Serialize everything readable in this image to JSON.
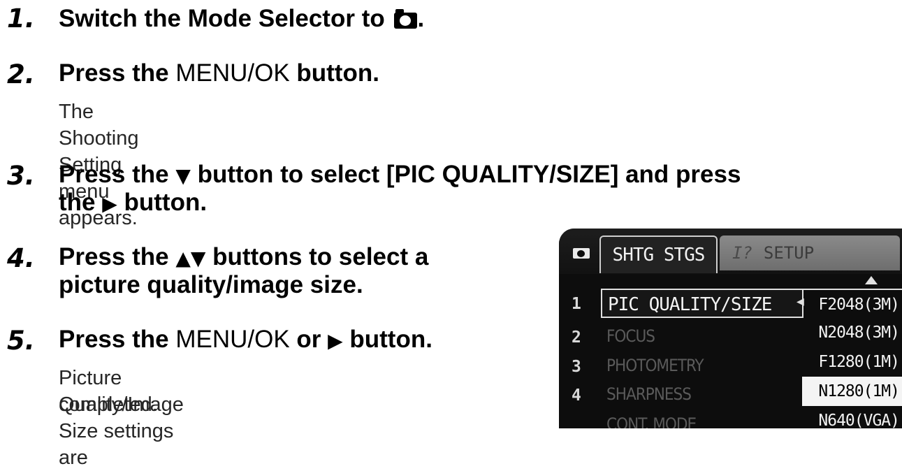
{
  "steps": [
    {
      "number": "1.",
      "heading_parts": [
        "Switch the Mode Selector to ",
        "."
      ]
    },
    {
      "number": "2.",
      "heading_parts": [
        "Press the ",
        "MENU/OK",
        " button."
      ],
      "body": "The Shooting Setting menu appears."
    },
    {
      "number": "3.",
      "heading_line1_parts": [
        "Press the ",
        "▼",
        " button to select [PIC QUALITY/SIZE] and press"
      ],
      "heading_line2_parts": [
        "the ",
        "▶",
        " button."
      ]
    },
    {
      "number": "4.",
      "heading_line1_parts": [
        "Press the ",
        "▲▼",
        " buttons to select a"
      ],
      "heading_line2": "picture quality/image size."
    },
    {
      "number": "5.",
      "heading_parts": [
        "Press the ",
        "MENU/OK",
        " or ",
        "▶",
        " button."
      ],
      "body_line1": "Picture Quality/Image Size settings are",
      "body_line2": "completed."
    }
  ],
  "icons": {
    "mode_icon": "camera-icon"
  },
  "screen": {
    "tab_active": "SHTG STGS",
    "tab_setup": "SETUP",
    "tab_setup_icon": "I?",
    "rows": [
      {
        "number": "1",
        "label": "PIC QUALITY/SIZE"
      },
      {
        "number": "2",
        "label": "FOCUS"
      },
      {
        "number": "3",
        "label": "PHOTOMETRY"
      },
      {
        "number": "4",
        "label": "SHARPNESS"
      },
      {
        "number": "",
        "label": "CONT. MODE"
      }
    ],
    "submenu": [
      "F2048(3M)",
      "N2048(3M)",
      "F1280(1M)",
      "N1280(1M)",
      "N640(VGA)"
    ],
    "submenu_selected_index": 3
  }
}
